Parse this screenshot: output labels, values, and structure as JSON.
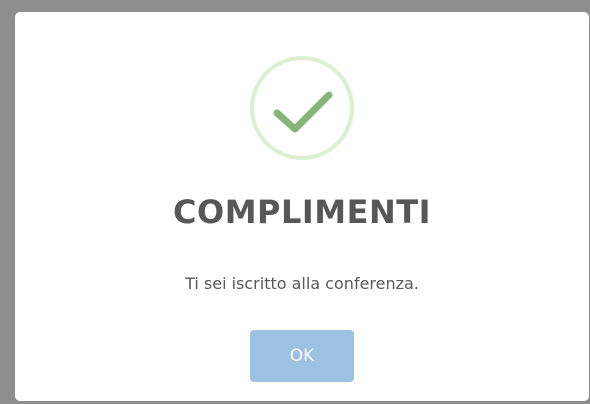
{
  "dialog": {
    "icon": "success-check-icon",
    "title": "COMPLIMENTI",
    "message": "Ti sei iscritto alla conferenza.",
    "ok_label": "OK"
  },
  "colors": {
    "success_ring": "#dcefd1",
    "success_check": "#86b57a",
    "button_bg": "#9cc1e3",
    "title_text": "#575757",
    "overlay": "#8e8e8e"
  }
}
